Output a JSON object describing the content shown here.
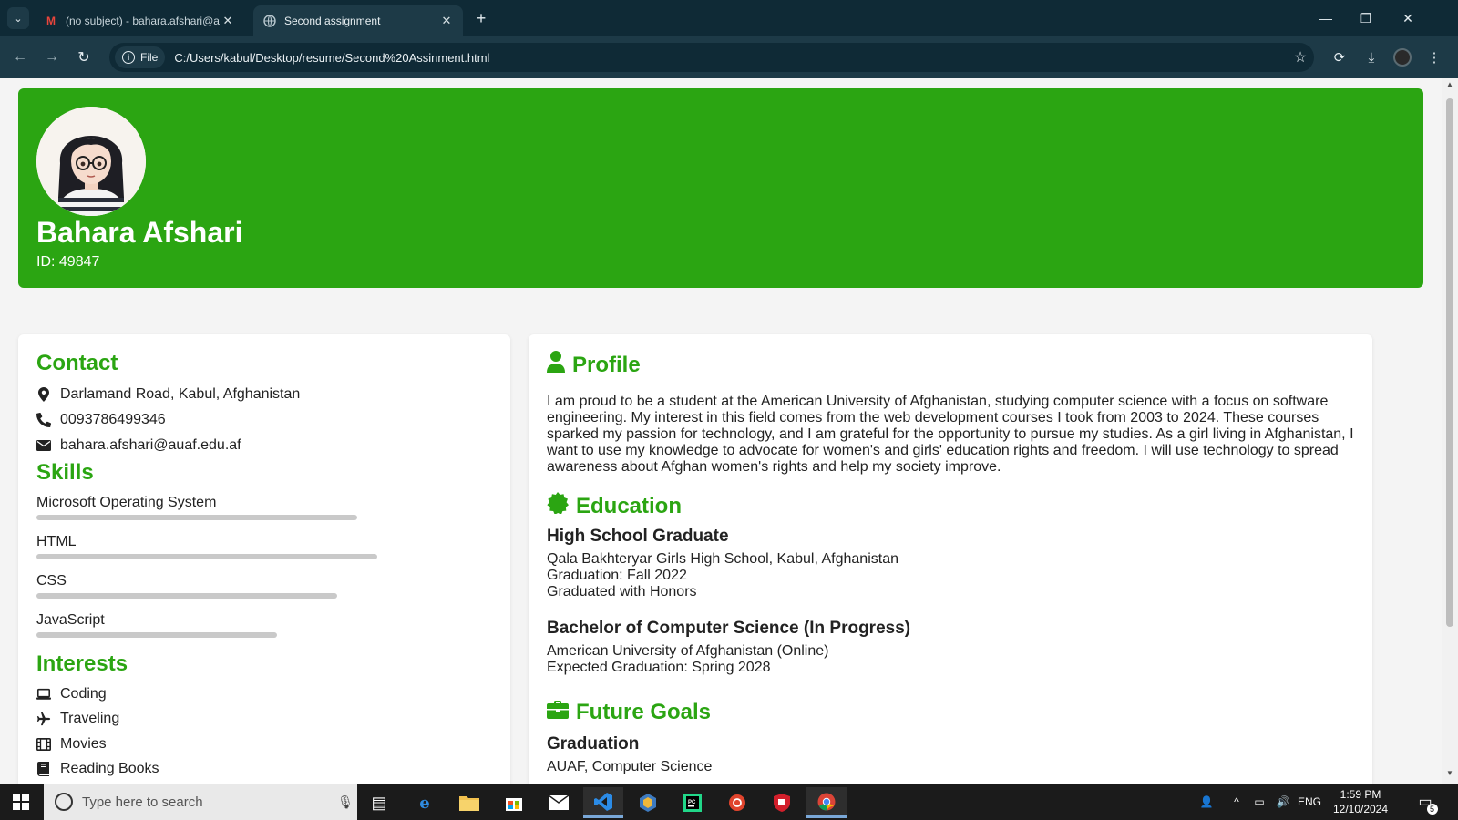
{
  "browser": {
    "tabs": [
      {
        "title": "(no subject) - bahara.afshari@a",
        "favicon": "gmail-icon",
        "active": false
      },
      {
        "title": "Second assignment",
        "favicon": "globe-icon",
        "active": true
      }
    ],
    "address": {
      "scheme_label": "File",
      "url": "C:/Users/kabul/Desktop/resume/Second%20Assinment.html"
    }
  },
  "header": {
    "name": "Bahara Afshari",
    "id_text": "ID: 49847",
    "color": "#2ba512"
  },
  "contact": {
    "heading": "Contact",
    "items": [
      {
        "icon": "map-pin-icon",
        "text": "Darlamand Road, Kabul, Afghanistan"
      },
      {
        "icon": "phone-icon",
        "text": "0093786499346"
      },
      {
        "icon": "envelope-icon",
        "text": "bahara.afshari@auaf.edu.af"
      }
    ]
  },
  "skills": {
    "heading": "Skills",
    "items": [
      {
        "label": "Microsoft Operating System",
        "level": 0.8
      },
      {
        "label": "HTML",
        "level": 0.85
      },
      {
        "label": "CSS",
        "level": 0.75
      },
      {
        "label": "JavaScript",
        "level": 0.6
      }
    ]
  },
  "interests": {
    "heading": "Interests",
    "items": [
      {
        "icon": "laptop-icon",
        "text": "Coding"
      },
      {
        "icon": "plane-icon",
        "text": "Traveling"
      },
      {
        "icon": "film-icon",
        "text": "Movies"
      },
      {
        "icon": "book-icon",
        "text": "Reading Books"
      }
    ]
  },
  "profile": {
    "heading": "Profile",
    "text": "I am proud to be a student at the American University of Afghanistan, studying computer science with a focus on software engineering. My interest in this field comes from the web development courses I took from 2003 to 2024. These courses sparked my passion for technology, and I am grateful for the opportunity to pursue my studies. As a girl living in Afghanistan, I want to use my knowledge to advocate for women's and girls' education rights and freedom. I will use technology to spread awareness about Afghan women's rights and help my society improve."
  },
  "education": {
    "heading": "Education",
    "entries": [
      {
        "title": "High School Graduate",
        "lines": [
          "Qala Bakhteryar Girls High School, Kabul, Afghanistan",
          "Graduation: Fall 2022",
          "Graduated with Honors"
        ]
      },
      {
        "title": "Bachelor of Computer Science (In Progress)",
        "lines": [
          "American University of Afghanistan (Online)",
          "Expected Graduation: Spring 2028"
        ]
      }
    ]
  },
  "goals": {
    "heading": "Future Goals",
    "entries": [
      {
        "title": "Graduation",
        "lines": [
          "AUAF, Computer Science"
        ]
      }
    ]
  },
  "taskbar": {
    "search_placeholder": "Type here to search",
    "language": "ENG",
    "time": "1:59 PM",
    "date": "12/10/2024",
    "notification_count": "5"
  }
}
